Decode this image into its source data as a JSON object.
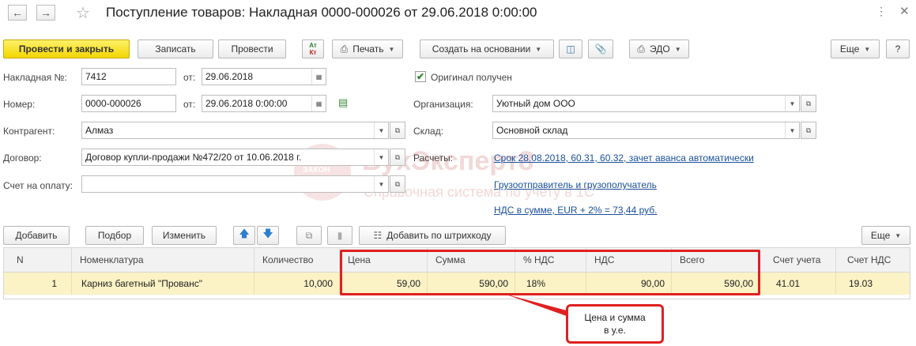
{
  "window": {
    "title": "Поступление товаров: Накладная 0000-000026 от 29.06.2018 0:00:00"
  },
  "toolbar": {
    "post_close": "Провести и закрыть",
    "save": "Записать",
    "post": "Провести",
    "dtkt_top": "Ат",
    "dtkt_bottom": "Кт",
    "print": "Печать",
    "create_based": "Создать на основании",
    "edo": "ЭДО",
    "more": "Еще",
    "help": "?"
  },
  "form": {
    "invoice_label": "Накладная №:",
    "invoice_value": "7412",
    "from_label": "от:",
    "invoice_date": "29.06.2018",
    "original_label": "Оригинал получен",
    "number_label": "Номер:",
    "number_value": "0000-000026",
    "number_date": "29.06.2018  0:00:00",
    "org_label": "Организация:",
    "org_value": "Уютный дом ООО",
    "counterparty_label": "Контрагент:",
    "counterparty_value": "Алмаз",
    "warehouse_label": "Склад:",
    "warehouse_value": "Основной склад",
    "contract_label": "Договор:",
    "contract_value": "Договор купли-продажи №472/20 от 10.06.2018 г.",
    "settlements_label": "Расчеты:",
    "settlements_link": "Срок 28.08.2018, 60.31, 60.32, зачет аванса автоматически",
    "payment_label": "Счет на оплату:",
    "payment_value": "",
    "shipper_link": "Грузоотправитель и грузополучатель",
    "vat_link": "НДС в сумме, EUR + 2% = 73,44 руб."
  },
  "watermark": {
    "brand": "БухЭксперт8",
    "subtitle": "Справочная система по учету в 1С",
    "badge": "ЗАКОН"
  },
  "table_toolbar": {
    "add": "Добавить",
    "select": "Подбор",
    "change": "Изменить",
    "barcode": "Добавить по штрихкоду",
    "more": "Еще"
  },
  "table": {
    "columns": [
      "N",
      "Номенклатура",
      "Количество",
      "Цена",
      "Сумма",
      "% НДС",
      "НДС",
      "Всего",
      "Счет учета",
      "Счет НДС"
    ],
    "rows": [
      {
        "n": "1",
        "item": "Карниз багетный \"Прованс\"",
        "qty": "10,000",
        "price": "59,00",
        "sum": "590,00",
        "vat_rate": "18%",
        "vat": "90,00",
        "total": "590,00",
        "account": "41.01",
        "vat_account": "19.03"
      }
    ]
  },
  "annotation": {
    "line1": "Цена и сумма",
    "line2": "в у.е."
  },
  "colors": {
    "primary": "#f2d600",
    "highlight": "#e02020",
    "link": "#1a4f9c",
    "selected_row": "#fbf2c5"
  }
}
